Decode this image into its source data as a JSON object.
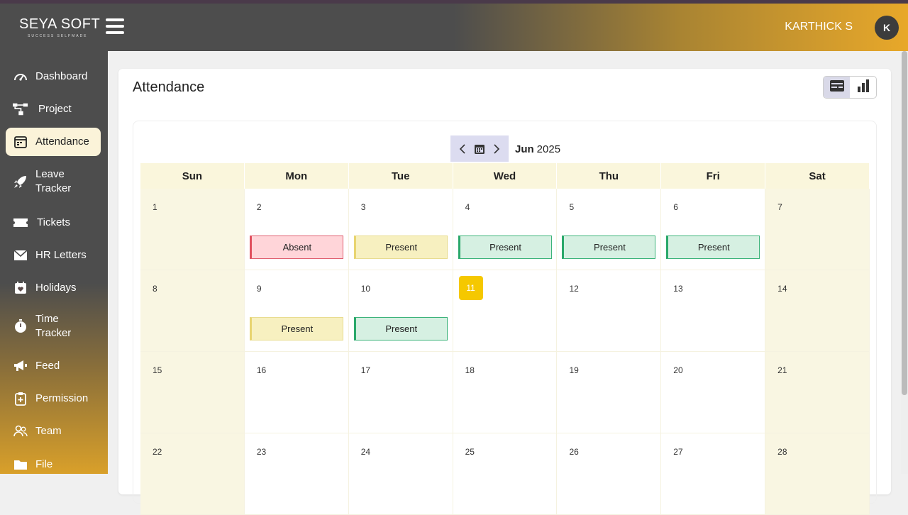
{
  "header": {
    "logo_text": "SEYA SOFT",
    "logo_tagline": "SUCCESS SELFMADE",
    "username": "KARTHICK S",
    "avatar_initial": "K"
  },
  "sidebar": {
    "items": [
      {
        "label": "Dashboard",
        "icon": "dashboard-icon"
      },
      {
        "label": "Project",
        "icon": "project-icon"
      },
      {
        "label": "Attendance",
        "icon": "calendar-icon",
        "active": true
      },
      {
        "label": "Leave Tracker",
        "icon": "rocket-icon"
      },
      {
        "label": "Tickets",
        "icon": "ticket-icon"
      },
      {
        "label": "HR Letters",
        "icon": "mail-icon"
      },
      {
        "label": "Holidays",
        "icon": "holiday-calendar-icon"
      },
      {
        "label": "Time Tracker",
        "icon": "stopwatch-icon"
      },
      {
        "label": "Feed",
        "icon": "megaphone-icon"
      },
      {
        "label": "Permission",
        "icon": "clipboard-icon"
      },
      {
        "label": "Team",
        "icon": "team-icon"
      },
      {
        "label": "File",
        "icon": "folder-icon"
      }
    ]
  },
  "page": {
    "title": "Attendance"
  },
  "calendar": {
    "month": "Jun",
    "year": "2025",
    "weekdays": [
      "Sun",
      "Mon",
      "Tue",
      "Wed",
      "Thu",
      "Fri",
      "Sat"
    ],
    "weeks": [
      [
        "1",
        "2",
        "3",
        "4",
        "5",
        "6",
        "7"
      ],
      [
        "8",
        "9",
        "10",
        "11",
        "12",
        "13",
        "14"
      ],
      [
        "15",
        "16",
        "17",
        "18",
        "19",
        "20",
        "21"
      ],
      [
        "22",
        "23",
        "24",
        "25",
        "26",
        "27",
        "28"
      ]
    ],
    "today": "11",
    "events": {
      "2": "Absent",
      "3": "Present",
      "4": "Present",
      "5": "Present",
      "6": "Present",
      "9": "Present",
      "10": "Present"
    }
  },
  "colors": {
    "accent": "#f5c800",
    "absent": "#e0505e",
    "present_green": "#2aa86a",
    "present_yellow": "#e8d470"
  }
}
